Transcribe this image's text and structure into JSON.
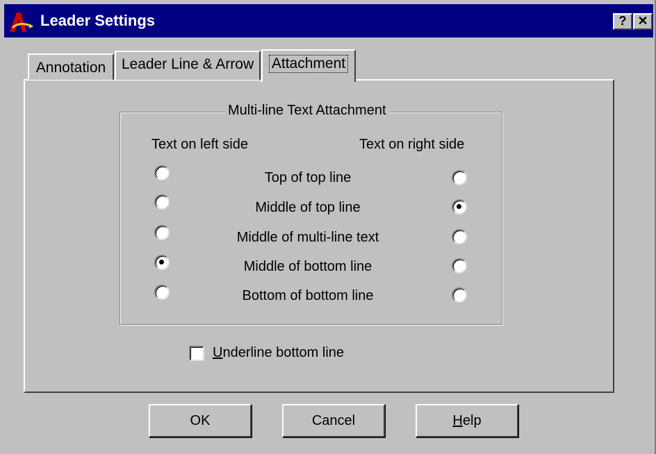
{
  "window": {
    "title": "Leader Settings",
    "help_button": "?",
    "close_button": "✕"
  },
  "tabs": [
    {
      "label": "Annotation",
      "active": false
    },
    {
      "label": "Leader Line & Arrow",
      "active": false
    },
    {
      "label": "Attachment",
      "active": true
    }
  ],
  "group": {
    "title": "Multi-line Text Attachment",
    "left_heading": "Text on left side",
    "right_heading": "Text on right side",
    "options": [
      {
        "label": "Top of top line",
        "left_selected": false,
        "right_selected": false
      },
      {
        "label": "Middle of top line",
        "left_selected": false,
        "right_selected": true
      },
      {
        "label": "Middle of multi-line text",
        "left_selected": false,
        "right_selected": false
      },
      {
        "label": "Middle of bottom line",
        "left_selected": true,
        "right_selected": false
      },
      {
        "label": "Bottom of bottom line",
        "left_selected": false,
        "right_selected": false
      }
    ]
  },
  "underline": {
    "label_first": "U",
    "label_rest": "nderline bottom line",
    "checked": false
  },
  "buttons": {
    "ok": "OK",
    "cancel": "Cancel",
    "help_first": "H",
    "help_rest": "elp"
  },
  "colors": {
    "titlebar": "#000080",
    "face": "#c0c0c0"
  }
}
